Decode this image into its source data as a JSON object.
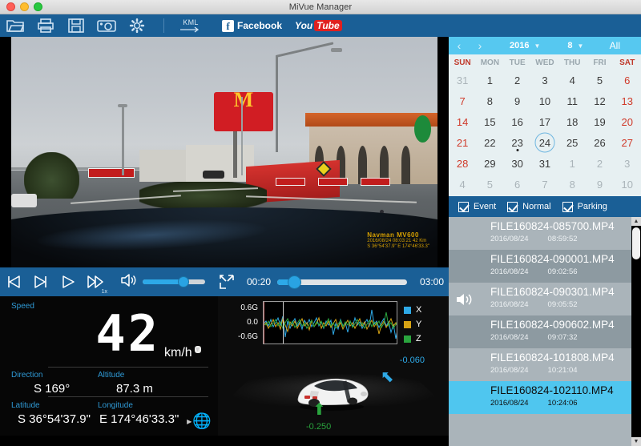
{
  "window": {
    "title": "MiVue Manager"
  },
  "toolbar": {
    "icons": [
      {
        "name": "open-folder-icon",
        "label": "Open"
      },
      {
        "name": "print-icon",
        "label": "Print"
      },
      {
        "name": "save-icon",
        "label": "Save"
      },
      {
        "name": "snapshot-camera-icon",
        "label": "Snapshot"
      },
      {
        "name": "settings-gear-icon",
        "label": "Settings"
      }
    ],
    "kml_label": "KML",
    "facebook_mark": "f",
    "facebook_label": "Facebook",
    "youtube_you": "You",
    "youtube_tube": "Tube"
  },
  "video": {
    "watermark_line1": "Navman MV600",
    "watermark_line2": "2016/08/24 08:03:21  42 Km",
    "watermark_line3": "S 36°54'37.9\"  E 174°46'33.3\""
  },
  "transport": {
    "prev_label": "Previous",
    "next_label": "Next",
    "play_label": "Play",
    "fast_label": "Fast forward",
    "speed_multiplier": "1x",
    "volume_icon": "speaker-icon",
    "volume_percent": 62,
    "fullscreen_label": "Fullscreen",
    "current_time": "00:20",
    "total_time": "03:00",
    "seek_percent": 11
  },
  "telemetry": {
    "speed_label": "Speed",
    "speed_value": "42",
    "speed_unit": "km/h",
    "direction_label": "Direction",
    "direction_value": "S 169°",
    "altitude_label": "Altitude",
    "altitude_value": "87.3  m",
    "latitude_label": "Latitude",
    "latitude_value": "S 36°54'37.9\"",
    "longitude_label": "Longitude",
    "longitude_value": "E 174°46'33.3\"",
    "map_icon": "globe-icon"
  },
  "gsensor": {
    "axis_top": "0.6G",
    "axis_mid": "0.0",
    "axis_bottom": "-0.6G",
    "legend": [
      {
        "key": "X",
        "color": "#2ea9e6"
      },
      {
        "key": "Y",
        "color": "#d7a314"
      },
      {
        "key": "Z",
        "color": "#2aa53e"
      }
    ],
    "value_x": "-0.060",
    "value_y": "-0.250",
    "color_x": "#2ea9e6",
    "color_y": "#2aa53e"
  },
  "calendar": {
    "prev_icon": "chevron-left-icon",
    "next_icon": "chevron-right-icon",
    "year": "2016",
    "month": "8",
    "all_label": "All",
    "dow": [
      "SUN",
      "MON",
      "TUE",
      "WED",
      "THU",
      "FRI",
      "SAT"
    ],
    "weeks": [
      [
        {
          "d": "31",
          "out": true
        },
        {
          "d": "1"
        },
        {
          "d": "2"
        },
        {
          "d": "3"
        },
        {
          "d": "4"
        },
        {
          "d": "5"
        },
        {
          "d": "6",
          "wk": true
        }
      ],
      [
        {
          "d": "7",
          "wk": true
        },
        {
          "d": "8"
        },
        {
          "d": "9"
        },
        {
          "d": "10"
        },
        {
          "d": "11"
        },
        {
          "d": "12"
        },
        {
          "d": "13",
          "wk": true
        }
      ],
      [
        {
          "d": "14",
          "wk": true
        },
        {
          "d": "15"
        },
        {
          "d": "16"
        },
        {
          "d": "17"
        },
        {
          "d": "18"
        },
        {
          "d": "19"
        },
        {
          "d": "20",
          "wk": true
        }
      ],
      [
        {
          "d": "21",
          "wk": true
        },
        {
          "d": "22"
        },
        {
          "d": "23",
          "pip": true
        },
        {
          "d": "24",
          "today": true
        },
        {
          "d": "25"
        },
        {
          "d": "26"
        },
        {
          "d": "27",
          "wk": true
        }
      ],
      [
        {
          "d": "28",
          "wk": true
        },
        {
          "d": "29"
        },
        {
          "d": "30"
        },
        {
          "d": "31"
        },
        {
          "d": "1",
          "out": true
        },
        {
          "d": "2",
          "out": true
        },
        {
          "d": "3",
          "out": true
        }
      ],
      [
        {
          "d": "4",
          "out": true
        },
        {
          "d": "5",
          "out": true
        },
        {
          "d": "6",
          "out": true
        },
        {
          "d": "7",
          "out": true
        },
        {
          "d": "8",
          "out": true
        },
        {
          "d": "9",
          "out": true
        },
        {
          "d": "10",
          "out": true
        }
      ]
    ]
  },
  "filters": [
    {
      "label": "Event",
      "checked": true
    },
    {
      "label": "Normal",
      "checked": true
    },
    {
      "label": "Parking",
      "checked": true
    }
  ],
  "files": [
    {
      "name": "FILE160824-085700.MP4",
      "date": "2016/08/24",
      "time": "08:59:52",
      "selected": false,
      "playing": false
    },
    {
      "name": "FILE160824-090001.MP4",
      "date": "2016/08/24",
      "time": "09:02:56",
      "selected": false,
      "playing": false
    },
    {
      "name": "FILE160824-090301.MP4",
      "date": "2016/08/24",
      "time": "09:05:52",
      "selected": false,
      "playing": true
    },
    {
      "name": "FILE160824-090602.MP4",
      "date": "2016/08/24",
      "time": "09:07:32",
      "selected": false,
      "playing": false
    },
    {
      "name": "FILE160824-101808.MP4",
      "date": "2016/08/24",
      "time": "10:21:04",
      "selected": false,
      "playing": false
    },
    {
      "name": "FILE160824-102110.MP4",
      "date": "2016/08/24",
      "time": "10:24:06",
      "selected": true,
      "playing": false
    }
  ],
  "scrollbar": {
    "up_icon": "scroll-up-arrow-icon",
    "down_icon": "scroll-down-arrow-icon"
  },
  "colors": {
    "toolbar_blue": "#1a5f96",
    "calendar_header": "#56c8f0",
    "selection_cyan": "#4fc6ef",
    "accent_slider": "#2da9e8"
  }
}
